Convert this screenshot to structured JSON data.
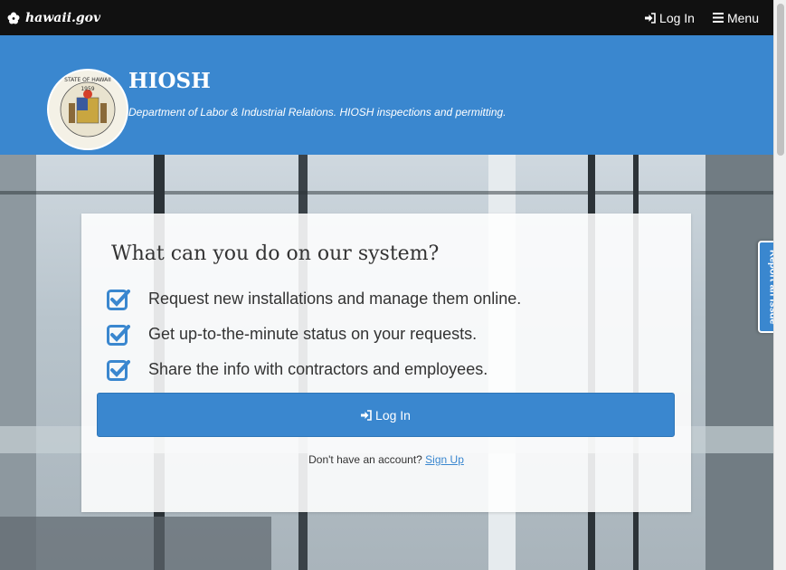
{
  "topbar": {
    "brand": "hawaii.gov",
    "login_label": "Log In",
    "menu_label": "Menu"
  },
  "header": {
    "title": "HIOSH",
    "subtitle": "Department of Labor & Industrial Relations. HIOSH inspections and permitting.",
    "seal_text_top": "STATE OF HAWAII",
    "seal_year": "1959"
  },
  "card": {
    "title": "What can you do on our system?",
    "features": [
      "Request new installations and manage them online.",
      "Get up-to-the-minute status on your requests.",
      "Share the info with contractors and employees."
    ],
    "login_button": "Log In",
    "signup_prompt": "Don't have an account?",
    "signup_link": "Sign Up"
  },
  "report_tab": "Report an Issue",
  "colors": {
    "accent": "#3a87cf",
    "topbar": "#111111",
    "check": "#3a87cf"
  }
}
